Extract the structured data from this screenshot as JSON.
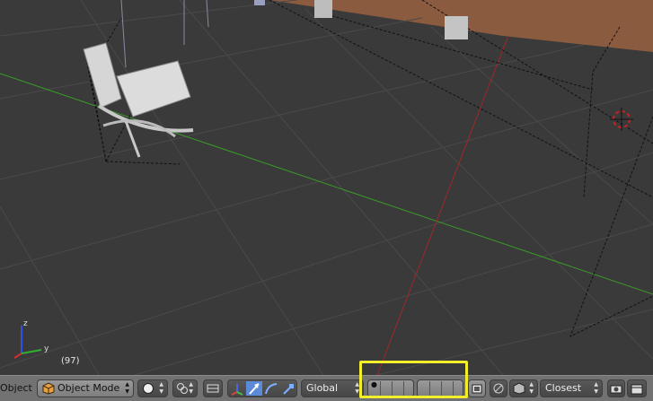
{
  "viewport": {
    "frame_counter": "(97)",
    "axis_gizmo": {
      "z_label": "z",
      "y_label": "y"
    },
    "colors": {
      "x_axis": "#a02828",
      "y_axis": "#3a9a2a",
      "grid": "#484848",
      "wall": "#8a5a40"
    }
  },
  "header": {
    "mode_partial": "Object",
    "interaction_mode": "Object Mode",
    "transform_orientation": "Global",
    "snap_element": "Closest",
    "icons": [
      "object-menu-icon",
      "viewport-shading-icon",
      "pivot-point-icon",
      "manipulator-icon",
      "translate-icon",
      "rotate-icon",
      "scale-icon",
      "layers-grid-icon",
      "layers-grid-icon",
      "layer-lock-icon",
      "proportional-edit-icon",
      "snap-icon",
      "render-icon",
      "render-anim-icon"
    ],
    "highlight_color": "#f2ef2a"
  }
}
